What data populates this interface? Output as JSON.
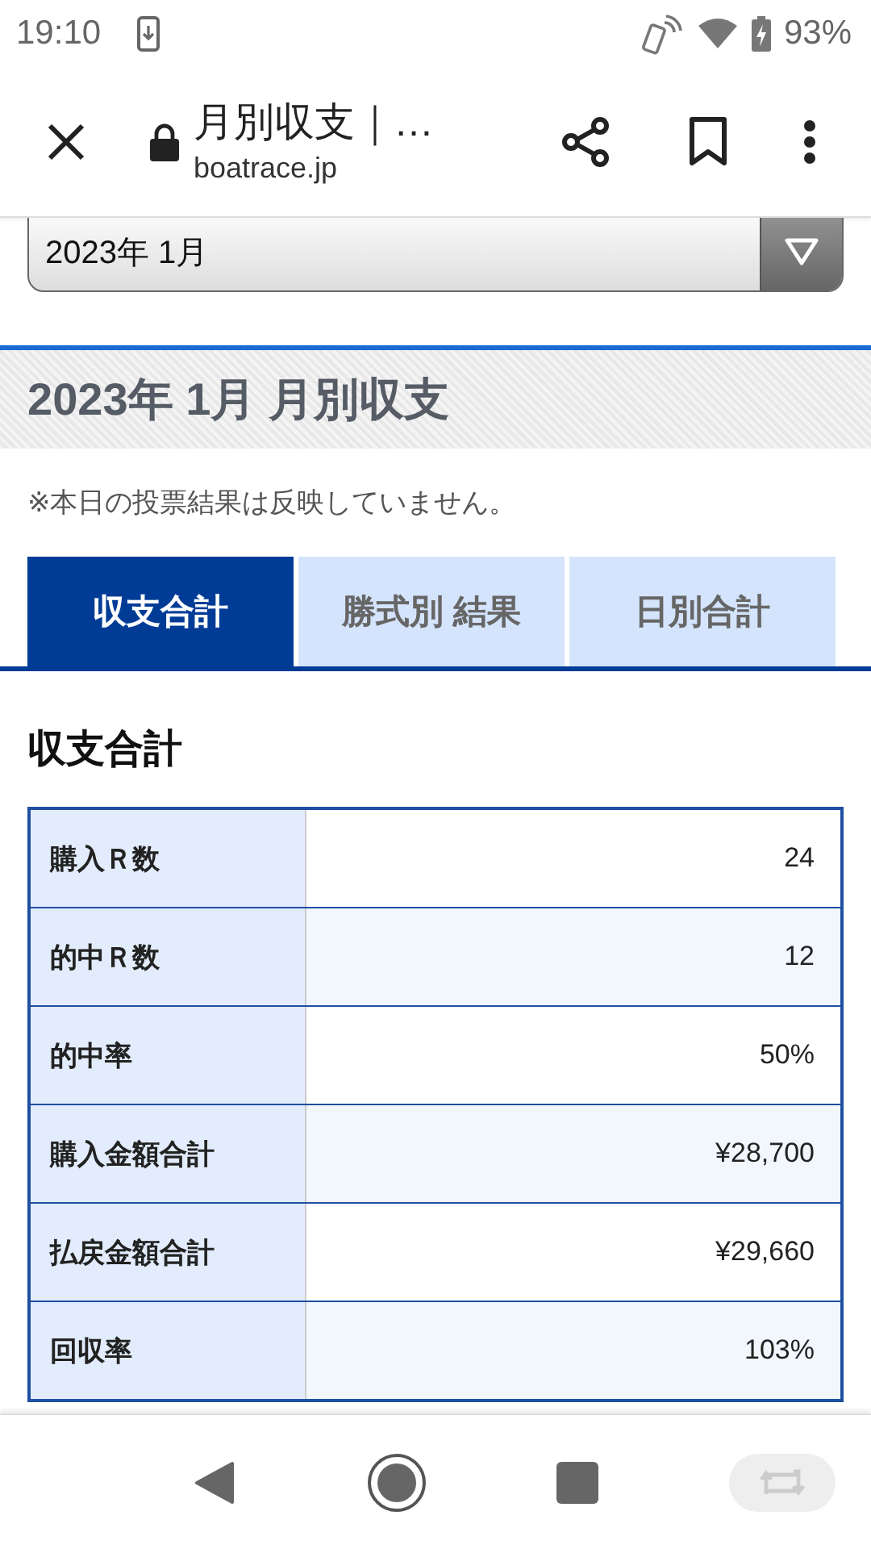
{
  "status_bar": {
    "time": "19:10",
    "battery": "93%"
  },
  "toolbar": {
    "title": "月別収支｜…",
    "url": "boatrace.jp"
  },
  "month_select": {
    "value": "2023年 1月"
  },
  "page_heading": "2023年 1月 月別収支",
  "note": "※本日の投票結果は反映していません。",
  "tabs": [
    {
      "label": "収支合計",
      "selected": true
    },
    {
      "label": "勝式別 結果",
      "selected": false
    },
    {
      "label": "日別合計",
      "selected": false
    }
  ],
  "section_title": "収支合計",
  "table": {
    "rows": [
      {
        "label": "購入Ｒ数",
        "value": "24"
      },
      {
        "label": "的中Ｒ数",
        "value": "12"
      },
      {
        "label": "的中率",
        "value": "50%"
      },
      {
        "label": "購入金額合計",
        "value": "¥28,700"
      },
      {
        "label": "払戻金額合計",
        "value": "¥29,660"
      },
      {
        "label": "回収率",
        "value": "103%"
      }
    ]
  }
}
